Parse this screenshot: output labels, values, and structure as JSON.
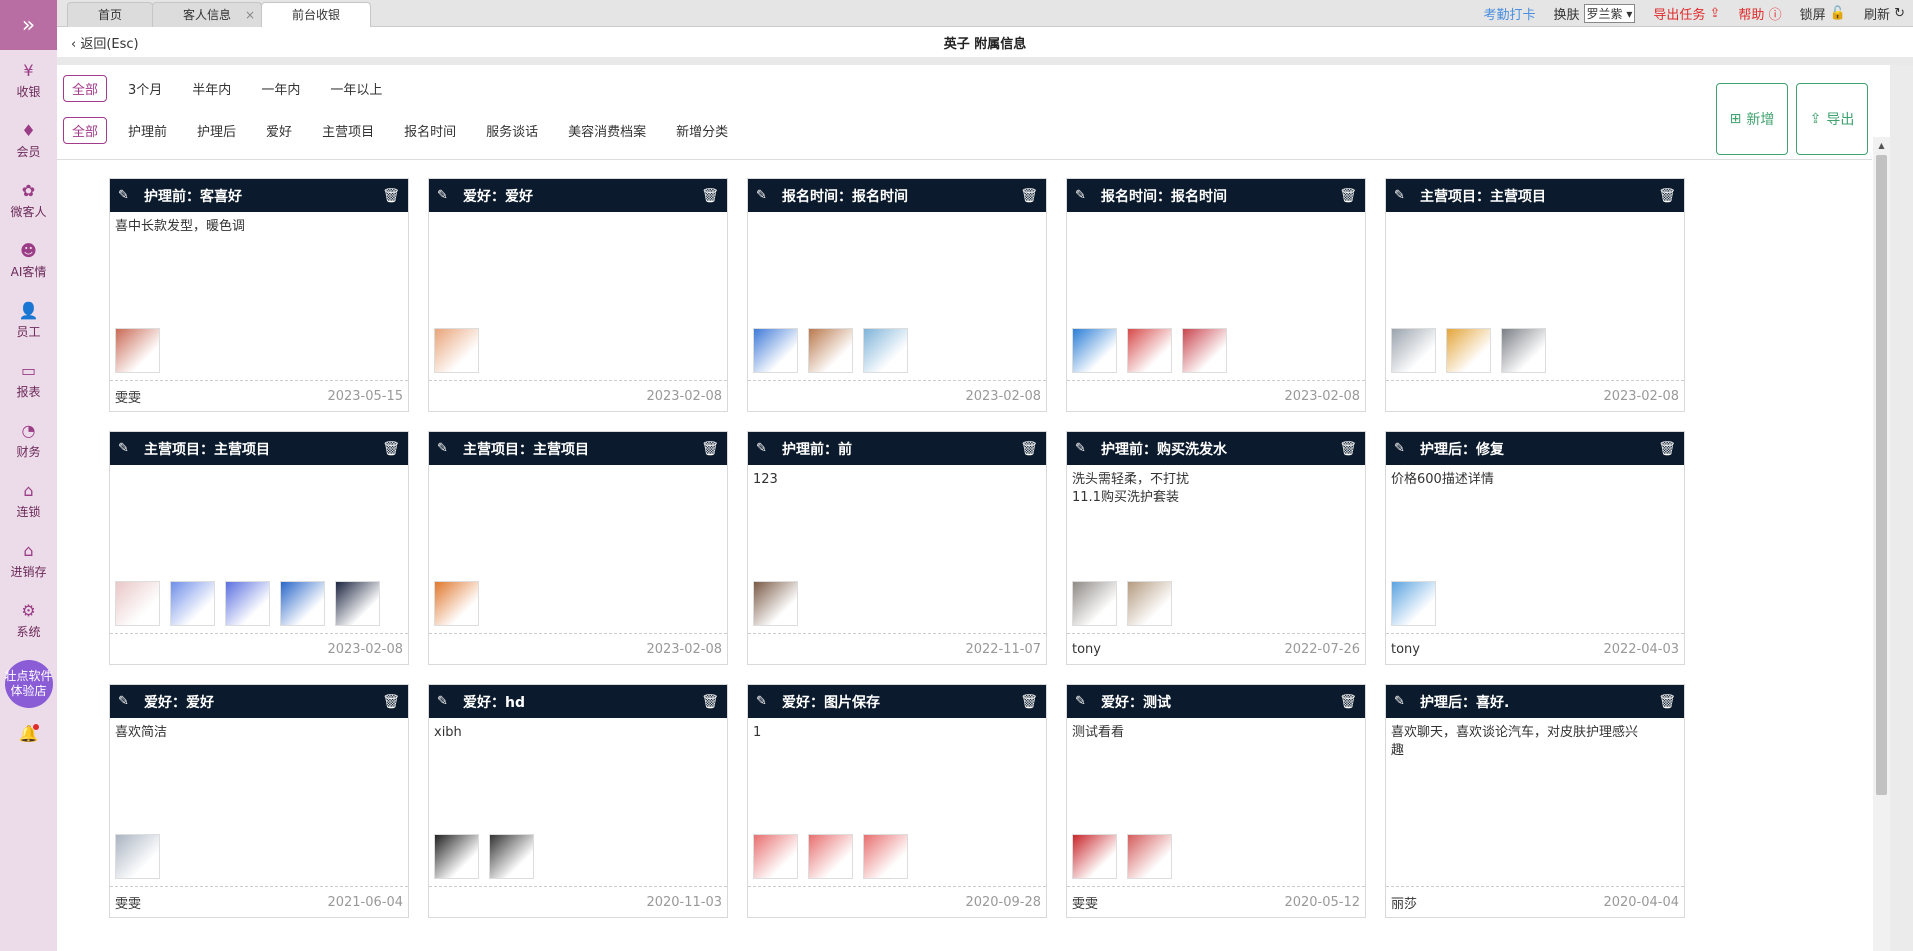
{
  "sidebar": {
    "items": [
      {
        "label": "收银",
        "icon": "cashier-icon"
      },
      {
        "label": "会员",
        "icon": "member-icon"
      },
      {
        "label": "微客人",
        "icon": "micro-guest-icon"
      },
      {
        "label": "AI客情",
        "icon": "ai-customer-icon"
      },
      {
        "label": "员工",
        "icon": "staff-icon"
      },
      {
        "label": "报表",
        "icon": "report-icon"
      },
      {
        "label": "财务",
        "icon": "finance-icon"
      },
      {
        "label": "连锁",
        "icon": "chain-icon"
      },
      {
        "label": "进销存",
        "icon": "inventory-icon"
      },
      {
        "label": "系统",
        "icon": "system-icon"
      }
    ],
    "store_line1": "壮点软件",
    "store_line2": "体验店"
  },
  "tabs": [
    {
      "label": "首页",
      "closable": false,
      "active": false
    },
    {
      "label": "客人信息",
      "closable": true,
      "active": false
    },
    {
      "label": "前台收银",
      "closable": false,
      "active": true
    }
  ],
  "topbar": {
    "checkin": "考勤打卡",
    "skin_label": "换肤",
    "skin_value": "罗兰紫",
    "export_task": "导出任务",
    "help": "帮助",
    "lock": "锁屏",
    "refresh": "刷新"
  },
  "header": {
    "back": "返回(Esc)",
    "title": "英子 附属信息"
  },
  "time_filters": [
    "全部",
    "3个月",
    "半年内",
    "一年内",
    "一年以上"
  ],
  "category_filters": [
    "全部",
    "护理前",
    "护理后",
    "爱好",
    "主营项目",
    "报名时间",
    "服务谈话",
    "美容消费档案",
    "新增分类"
  ],
  "actions": {
    "add": "新增",
    "export": "导出"
  },
  "cards": [
    {
      "title": "护理前：客喜好",
      "content": [
        "喜中长款发型，暖色调"
      ],
      "images": [
        "#c96a55"
      ],
      "author": "雯雯",
      "date": "2023-05-15"
    },
    {
      "title": "爱好：爱好",
      "content": [],
      "images": [
        "#e9a479"
      ],
      "author": "",
      "date": "2023-02-08"
    },
    {
      "title": "报名时间：报名时间",
      "content": [],
      "images": [
        "#3f7ad8",
        "#b9794d",
        "#7fb4d9"
      ],
      "author": "",
      "date": "2023-02-08"
    },
    {
      "title": "报名时间：报名时间",
      "content": [],
      "images": [
        "#2b7ed6",
        "#d64a4a",
        "#c9454f"
      ],
      "author": "",
      "date": "2023-02-08"
    },
    {
      "title": "主营项目：主营项目",
      "content": [],
      "images": [
        "#9aa3ad",
        "#e3a53a",
        "#7b7f86"
      ],
      "author": "",
      "date": "2023-02-08"
    },
    {
      "title": "主营项目：主营项目",
      "content": [],
      "images": [
        "#e9c7c7",
        "#6e8ee8",
        "#5a6fe0",
        "#2967c9",
        "#1c2540"
      ],
      "author": "",
      "date": "2023-02-08"
    },
    {
      "title": "主营项目：主营项目",
      "content": [],
      "images": [
        "#e0782e"
      ],
      "author": "",
      "date": "2023-02-08"
    },
    {
      "title": "护理前：前",
      "content": [
        "123"
      ],
      "images": [
        "#7a5a46"
      ],
      "author": "",
      "date": "2022-11-07"
    },
    {
      "title": "护理前：购买洗发水",
      "content": [
        "洗头需轻柔，不打扰",
        "11.1购买洗护套装"
      ],
      "images": [
        "#8f8a86",
        "#b49b80"
      ],
      "author": "tony",
      "date": "2022-07-26"
    },
    {
      "title": "护理后：修复",
      "content": [
        "价格600描述详情"
      ],
      "images": [
        "#5aa3e0"
      ],
      "author": "tony",
      "date": "2022-04-03"
    },
    {
      "title": "爱好：爱好",
      "content": [
        "喜欢简洁"
      ],
      "images": [
        "#aab4c2"
      ],
      "author": "雯雯",
      "date": "2021-06-04"
    },
    {
      "title": "爱好：hd",
      "content": [
        "xibh"
      ],
      "images": [
        "#222222",
        "#333333"
      ],
      "author": "",
      "date": "2020-11-03"
    },
    {
      "title": "爱好：图片保存",
      "content": [
        "1"
      ],
      "images": [
        "#e86f6f",
        "#e86f6f",
        "#e86f6f"
      ],
      "author": "",
      "date": "2020-09-28"
    },
    {
      "title": "爱好：测试",
      "content": [
        "测试看看"
      ],
      "images": [
        "#c8262b",
        "#d55c5c"
      ],
      "author": "雯雯",
      "date": "2020-05-12"
    },
    {
      "title": "护理后：喜好.",
      "content": [
        "喜欢聊天，喜欢谈论汽车，对皮肤护理感兴",
        "趣"
      ],
      "images": [],
      "author": "丽莎",
      "date": "2020-04-04"
    }
  ]
}
